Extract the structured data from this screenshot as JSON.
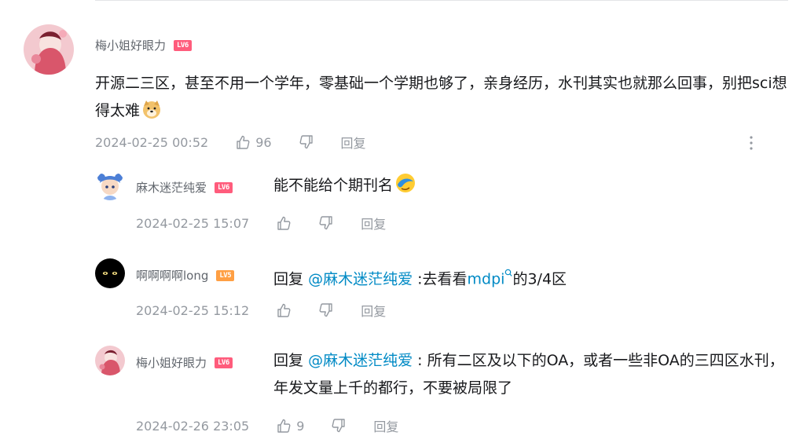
{
  "colors": {
    "mention": "#008ac5",
    "meta": "#9499a0",
    "username": "#61666d",
    "level_pink": "#ff5c7c",
    "level_orange": "#ff9f43"
  },
  "comment": {
    "username": "梅小姐好眼力",
    "level": "LV6",
    "text": "开源二三区，甚至不用一个学年，零基础一个学期也够了，亲身经历，水刊其实也就那么回事，别把sci想得太难",
    "emoji": "doge-emoji",
    "time": "2024-02-25 00:52",
    "likes": "96",
    "reply_label": "回复"
  },
  "replies": [
    {
      "username": "麻木迷茫纯爱",
      "level": "LV6",
      "text": "能不能给个期刊名",
      "emoji": "facepalm-emoji",
      "time": "2024-02-25 15:07",
      "likes": "",
      "reply_label": "回复"
    },
    {
      "username": "啊啊啊啊long",
      "level": "LV5",
      "reply_prefix": "回复",
      "mention": "@麻木迷茫纯爱",
      "text_before_link": ":去看看",
      "link_text": "mdpi",
      "text_after_link": "的3/4区",
      "time": "2024-02-25 15:12",
      "likes": "",
      "reply_label": "回复"
    },
    {
      "username": "梅小姐好眼力",
      "level": "LV6",
      "reply_prefix": "回复",
      "mention": "@麻木迷茫纯爱",
      "text": ": 所有二区及以下的OA，或者一些非OA的三四区水刊，年发文量上千的都行，不要被局限了",
      "time": "2024-02-26 23:05",
      "likes": "9",
      "reply_label": "回复"
    }
  ]
}
